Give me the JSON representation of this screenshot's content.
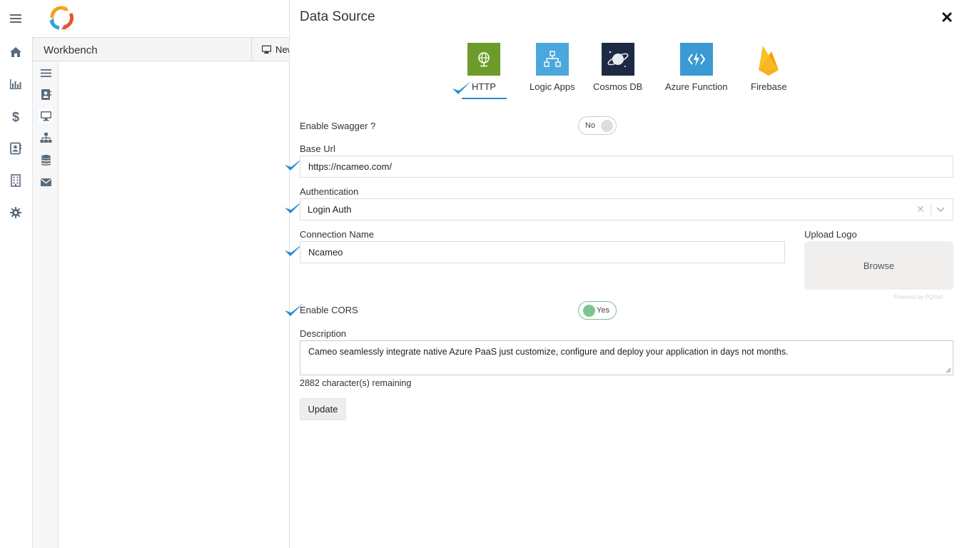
{
  "nav": {
    "items": [
      "menu-icon",
      "home-icon",
      "chart-icon",
      "dollar-icon",
      "contacts-icon",
      "building-icon",
      "gear-icon"
    ]
  },
  "workbench": {
    "title": "Workbench",
    "tab_label": "New"
  },
  "drawer": {
    "title": "Data Source",
    "types": [
      {
        "label": "HTTP",
        "color": "#6d9b2b"
      },
      {
        "label": "Logic Apps",
        "color": "#4aa8dc"
      },
      {
        "label": "Cosmos DB",
        "color": "#1e2a44"
      },
      {
        "label": "Azure Function",
        "color": "#3b99d4"
      },
      {
        "label": "Firebase",
        "color": "#f6b800"
      }
    ],
    "selected_type": "HTTP",
    "enable_swagger": {
      "label": "Enable Swagger ?",
      "state": "No"
    },
    "base_url": {
      "label": "Base Url",
      "value": "https://ncameo.com/"
    },
    "authentication": {
      "label": "Authentication",
      "value": "Login Auth",
      "clear": "✕"
    },
    "connection_name": {
      "label": "Connection Name",
      "value": "Ncameo"
    },
    "upload_logo": {
      "label": "Upload Logo",
      "button": "Browse",
      "powered": "Powered by PQINA"
    },
    "enable_cors": {
      "label": "Enable CORS",
      "state": "Yes"
    },
    "description": {
      "label": "Description",
      "value": "Cameo seamlessly integrate native Azure PaaS just customize, configure and deploy your application in days not months.",
      "remaining": "2882 character(s) remaining"
    },
    "update_button": "Update"
  },
  "colors": {
    "accent_check": "#2a8fd0",
    "toggle_on": "#7cc48f"
  }
}
